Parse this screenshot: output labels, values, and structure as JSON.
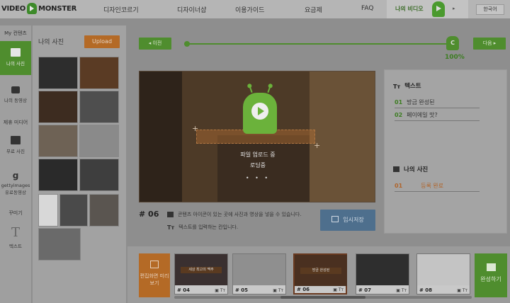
{
  "nav": {
    "logo_left": "VIDEO",
    "logo_right": "MONSTER",
    "items": [
      "디자인코르기",
      "디자이너샵",
      "이용가이드",
      "요금제",
      "FAQ"
    ],
    "my_video": "나의 비디오",
    "language": "한국어"
  },
  "rail": {
    "section1": "My 컨텐츠",
    "my_photos": "나의 사진",
    "my_videos": "나의 동영상",
    "section2": "제휴 미디어",
    "free_photos": "무료 사진",
    "getty": "gettyimages",
    "getty_sub": "유료동영상",
    "section3": "꾸미기",
    "text": "텍스트"
  },
  "photo_panel": {
    "title": "나의 사진",
    "upload": "Upload"
  },
  "progress": {
    "prev": "◂ 이전",
    "next": "다음 ▸",
    "knob": "C",
    "percent": "100%",
    "value": 1.0
  },
  "preview": {
    "uploading": "파일 업로드 중",
    "loading": "로딩중",
    "dots": "• • •"
  },
  "scene": {
    "number": "# 06",
    "hint_photo": "콘텐츠 아이콘이 있는 곳에 사진과 영상을 넣을 수 있습니다.",
    "hint_text": "텍스트를 입력하는 칸입니다.",
    "hint_text_icon": "Tт",
    "temp_save": "임시저장"
  },
  "right_panel": {
    "text_header": "텍스트",
    "text_icon": "Tт",
    "text_rows": [
      {
        "n": "01",
        "v": "방금 완성된"
      },
      {
        "n": "02",
        "v": "페이에일 맛?"
      }
    ],
    "photo_header": "나의 사진",
    "photo_rows": [
      {
        "n": "01",
        "v": "등록 완료"
      }
    ]
  },
  "timeline": {
    "preview_all": "편집화면 미리보기",
    "clips": [
      {
        "label": "# 04",
        "tag": "▣ Tт",
        "caption": "세상 최고의 맥주"
      },
      {
        "label": "# 05",
        "tag": "▣ Tт",
        "caption": ""
      },
      {
        "label": "# 06",
        "tag": "▣ Tт",
        "caption": "방금 완성된"
      },
      {
        "label": "# 07",
        "tag": "▣ Tт",
        "caption": ""
      },
      {
        "label": "# 08",
        "tag": "▣ Tт",
        "caption": ""
      }
    ],
    "finish": "완성하기"
  }
}
